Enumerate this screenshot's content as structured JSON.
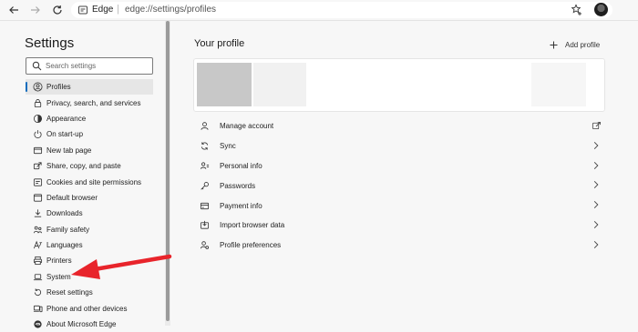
{
  "browser": {
    "brand": "Edge",
    "separator": "|",
    "url": "edge://settings/profiles"
  },
  "sidebar": {
    "title": "Settings",
    "search_placeholder": "Search settings",
    "items": [
      {
        "label": "Profiles",
        "icon": "profile-icon",
        "active": true
      },
      {
        "label": "Privacy, search, and services",
        "icon": "lock-icon"
      },
      {
        "label": "Appearance",
        "icon": "appearance-icon"
      },
      {
        "label": "On start-up",
        "icon": "power-icon"
      },
      {
        "label": "New tab page",
        "icon": "new-tab-icon"
      },
      {
        "label": "Share, copy, and paste",
        "icon": "share-icon"
      },
      {
        "label": "Cookies and site permissions",
        "icon": "cookie-icon"
      },
      {
        "label": "Default browser",
        "icon": "browser-icon"
      },
      {
        "label": "Downloads",
        "icon": "download-icon"
      },
      {
        "label": "Family safety",
        "icon": "family-icon"
      },
      {
        "label": "Languages",
        "icon": "language-icon"
      },
      {
        "label": "Printers",
        "icon": "printer-icon"
      },
      {
        "label": "System",
        "icon": "laptop-icon"
      },
      {
        "label": "Reset settings",
        "icon": "reset-icon"
      },
      {
        "label": "Phone and other devices",
        "icon": "phone-icon"
      },
      {
        "label": "About Microsoft Edge",
        "icon": "edge-icon"
      }
    ]
  },
  "main": {
    "title": "Your profile",
    "add_profile": "Add profile",
    "rows": [
      {
        "label": "Manage account",
        "icon": "person-icon",
        "trail": "external-link-icon"
      },
      {
        "label": "Sync",
        "icon": "sync-icon",
        "trail": "chevron-right-icon"
      },
      {
        "label": "Personal info",
        "icon": "id-card-icon",
        "trail": "chevron-right-icon"
      },
      {
        "label": "Passwords",
        "icon": "key-icon",
        "trail": "chevron-right-icon"
      },
      {
        "label": "Payment info",
        "icon": "card-icon",
        "trail": "chevron-right-icon"
      },
      {
        "label": "Import browser data",
        "icon": "import-icon",
        "trail": "chevron-right-icon"
      },
      {
        "label": "Profile preferences",
        "icon": "profile-settings-icon",
        "trail": "chevron-right-icon"
      }
    ]
  },
  "colors": {
    "accent": "#0f6cbd",
    "annotation_arrow": "#e8242b"
  }
}
